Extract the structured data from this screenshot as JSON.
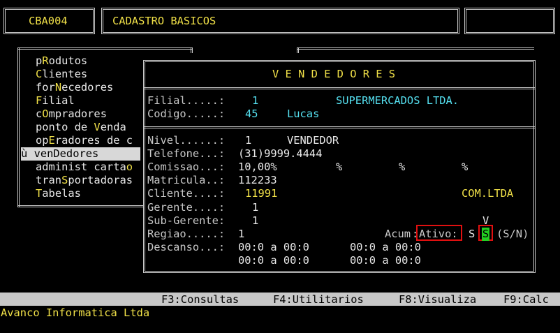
{
  "header": {
    "code": "CBA004",
    "title": "CADASTRO BASICOS"
  },
  "menu": {
    "items": [
      {
        "pre": "p",
        "key": "R",
        "post": "odutos"
      },
      {
        "pre": "",
        "key": "C",
        "post": "lientes"
      },
      {
        "pre": "for",
        "key": "N",
        "post": "ecedores"
      },
      {
        "pre": "",
        "key": "F",
        "post": "ilial"
      },
      {
        "pre": "c",
        "key": "O",
        "post": "mpradores"
      },
      {
        "pre": "ponto de ",
        "key": "V",
        "post": "enda"
      },
      {
        "pre": "op",
        "key": "E",
        "post": "radores de c"
      },
      {
        "pre": "ven",
        "key": "D",
        "post": "edores"
      },
      {
        "pre": "administ carta",
        "key": "o",
        "post": ""
      },
      {
        "pre": "tran",
        "key": "S",
        "post": "portadoras"
      },
      {
        "pre": "",
        "key": "T",
        "post": "abelas"
      }
    ],
    "selected_marker": "ù"
  },
  "dialog": {
    "title": "V E N D E D O R E S",
    "filial_label": "Filial.....:",
    "filial_value": "1",
    "filial_name": "SUPERMERCADOS LTDA.",
    "codigo_label": "Codigo.....:",
    "codigo_value": "45",
    "codigo_name": "Lucas",
    "nivel_label": "Nivel......:",
    "nivel_value": "1",
    "nivel_desc": "VENDEDOR",
    "telefone_label": "Telefone...:",
    "telefone_value": "(31)9999.4444",
    "comissao_label": "Comissao...:",
    "comissao_value": "10,00%",
    "pct": "%",
    "matricula_label": "Matricula..:",
    "matricula_value": "112233",
    "cliente_label": "Cliente....:",
    "cliente_value": "11991",
    "cliente_name": "COM.LTDA",
    "gerente_label": "Gerente....:",
    "gerente_value": "1",
    "subgerente_label": "Sub-Gerente:",
    "subgerente_value": "1",
    "regiao_label": "Regiao.....:",
    "regiao_value": "1",
    "acum_label": "Acum",
    "ativo_label": "Ativo:",
    "ativo_s1": "S",
    "ativo_s2": "S",
    "ativo_options": "(S/N)",
    "ativo_v": "V",
    "descanso_label": "Descanso...:",
    "descanso_r1a": "00:0 a 00:0",
    "descanso_r1b": "00:0 a 00:0",
    "descanso_r2a": "00:0 a 00:0",
    "descanso_r2b": "00:0 a 00:0"
  },
  "fkeys": {
    "f3": "F3:Consultas",
    "f4": "F4:Utilitarios",
    "f8": "F8:Visualiza",
    "f9": "F9:Calc"
  },
  "footer": {
    "company": "Avanco Informatica Ltda"
  }
}
